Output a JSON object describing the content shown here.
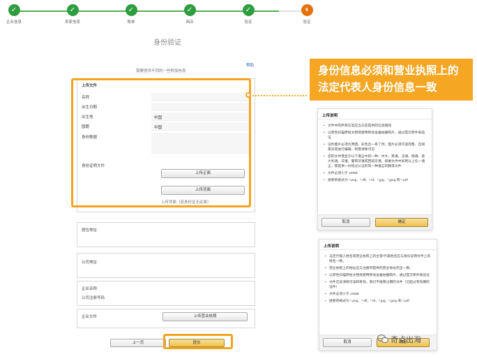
{
  "steps": [
    {
      "label": "企业信息",
      "done": true
    },
    {
      "label": "卖家信息",
      "done": true
    },
    {
      "label": "账单",
      "done": true
    },
    {
      "label": "商店",
      "done": true
    },
    {
      "label": "验证",
      "done": true
    },
    {
      "label": "验证",
      "done": false,
      "number": "6"
    }
  ],
  "page_title": "身份验证",
  "subtitle": "需要提供不同的一些附加信息",
  "help_link": "帮助",
  "upload_section": {
    "header": "上传文件",
    "rows": [
      {
        "label": "名称",
        "value": ""
      },
      {
        "label": "出生日期",
        "value": ""
      },
      {
        "label": "出生地",
        "value": "中国"
      },
      {
        "label": "国籍",
        "value": "中国"
      },
      {
        "label": "身份数据",
        "value": ""
      }
    ],
    "id_doc_label": "身份证明文件",
    "front_button": "上传正面",
    "back_button": "上传背面",
    "hint": "上传背面（若身份证无此面）"
  },
  "residence_label": "居住地址",
  "company_address_label": "公司地址",
  "company_name_label": "企业名称",
  "company_reg_label": "公司注册号码",
  "business_doc_label": "企业文件",
  "business_upload_button": "上传营业执照",
  "prev_button": "上一页",
  "submit_button": "提交",
  "callout_text": "身份信息必须和营业执照上的法定代表人身份信息一致",
  "panel1": {
    "title": "上传说明",
    "items": [
      "文件中的所有信息应当与您提供的信息相同",
      "以原色扫描原始文档或使用移动设备拍摄照片，通过提交原件来验证",
      "证件图片必须为原图，彩色且一目了然，图片必须可读完整，且如需对其进行编辑，则需清晰可见",
      "您的文件需显示以下语言中的一种：中文、英语、法语、德语、意大利语、日语、葡萄牙语或西班牙语。如果文件中采用以上任一语言，需提供一份经过公证的同一种语言的翻译文件",
      "文件必须小于 10MB",
      "接受的格式为 *.png、*.tiff、*.tif、*.jpg、*.jpeg 和 *.pdf"
    ],
    "cancel": "取消",
    "confirm": "确定"
  },
  "panel2": {
    "title": "上传说明",
    "items": [
      "法定代理人姓名或营业执照上的主管/代表姓名应与身份证明文件上的姓名一致。",
      "营业执照上的地址应与注册时提供的营业地址完全一致。",
      "以原色扫描原始文档或使用移动设备拍摄照片，通过提交原件来验证",
      "文件应该清晰可读和有效，我们不接受过期的文件（已超过有效期的证件）",
      "文件必须小于 10MB",
      "接受的格式为 *.png、*.tiff、*.tif、*.jpg、*.jpeg 和 *.pdf"
    ],
    "cancel": "取消",
    "confirm": "确定"
  },
  "watermark": "奇点出海",
  "colors": {
    "accent": "#f4a31e",
    "step_done": "#2e9d3f",
    "step_current": "#e4720c",
    "callout": "#f5a623"
  }
}
